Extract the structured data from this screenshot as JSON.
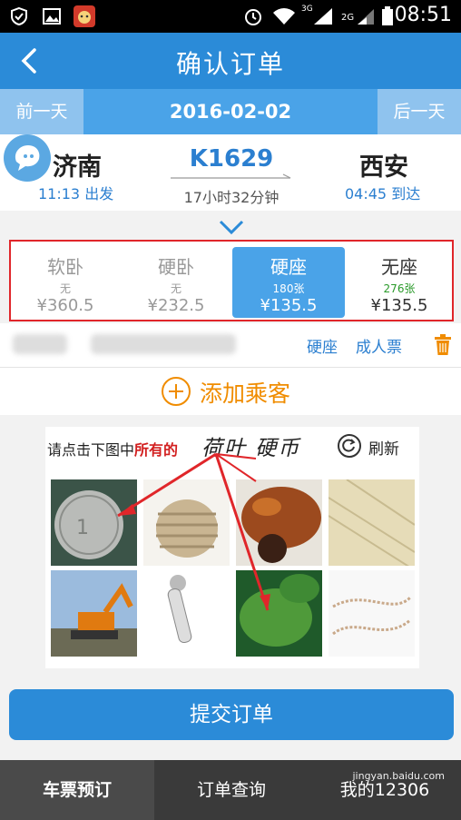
{
  "status_bar": {
    "time": "08:51",
    "signal_labels": [
      "3G",
      "2G"
    ]
  },
  "header": {
    "title": "确认订单"
  },
  "date_bar": {
    "prev_label": "前一天",
    "date": "2016-02-02",
    "next_label": "后一天"
  },
  "train": {
    "from_city": "济南",
    "depart_time": "11:13 出发",
    "train_no": "K1629",
    "duration": "17小时32分钟",
    "to_city": "西安",
    "arrive_time": "04:45 到达"
  },
  "seats": [
    {
      "name": "软卧",
      "availability": "无",
      "price": "¥360.5",
      "state": "unavailable"
    },
    {
      "name": "硬卧",
      "availability": "无",
      "price": "¥232.5",
      "state": "unavailable"
    },
    {
      "name": "硬座",
      "availability": "180张",
      "price": "¥135.5",
      "state": "selected"
    },
    {
      "name": "无座",
      "availability": "276张",
      "price": "¥135.5",
      "state": "available"
    }
  ],
  "passenger": {
    "seat_type": "硬座",
    "ticket_type": "成人票"
  },
  "add_passenger": {
    "label": "添加乘客"
  },
  "captcha": {
    "prompt_prefix": "请点击下图中",
    "prompt_highlight": "所有的",
    "target_words": "荷叶 硬币",
    "refresh_label": "刷新"
  },
  "submit": {
    "label": "提交订单"
  },
  "tabs": [
    {
      "label": "车票预订",
      "active": true
    },
    {
      "label": "订单查询",
      "active": false
    },
    {
      "label": "我的12306",
      "active": false
    }
  ],
  "watermark": {
    "text": "jingyan.baidu.com"
  },
  "colors": {
    "primary": "#2b8bd8",
    "accent": "#f08c00",
    "highlight_red": "#d21f1f",
    "available_green": "#2a9a2a"
  }
}
